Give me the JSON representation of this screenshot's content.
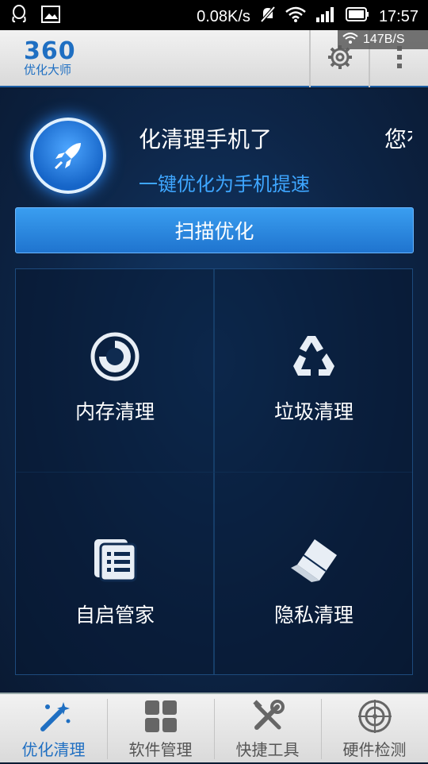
{
  "status_bar": {
    "net_speed": "0.08K/s",
    "time": "17:57"
  },
  "net_overlay": {
    "speed": "147B/S"
  },
  "app": {
    "logo_number": "360",
    "logo_subtitle": "优化大师"
  },
  "hero": {
    "ticker_text": "化清理手机了",
    "ticker_text_2": "您有",
    "subtitle": "一键优化为手机提速",
    "scan_button": "扫描优化"
  },
  "tiles": [
    {
      "label": "内存清理",
      "icon": "memory-gauge-icon"
    },
    {
      "label": "垃圾清理",
      "icon": "recycle-icon"
    },
    {
      "label": "自启管家",
      "icon": "list-document-icon"
    },
    {
      "label": "隐私清理",
      "icon": "eraser-icon"
    }
  ],
  "tabs": [
    {
      "label": "优化清理",
      "icon": "magic-wand-icon",
      "active": true
    },
    {
      "label": "软件管理",
      "icon": "apps-grid-icon",
      "active": false
    },
    {
      "label": "快捷工具",
      "icon": "tools-icon",
      "active": false
    },
    {
      "label": "硬件检测",
      "icon": "radar-icon",
      "active": false
    }
  ],
  "colors": {
    "accent": "#1f6fc2",
    "highlight": "#3ea6ff",
    "background": "#0d2547"
  }
}
